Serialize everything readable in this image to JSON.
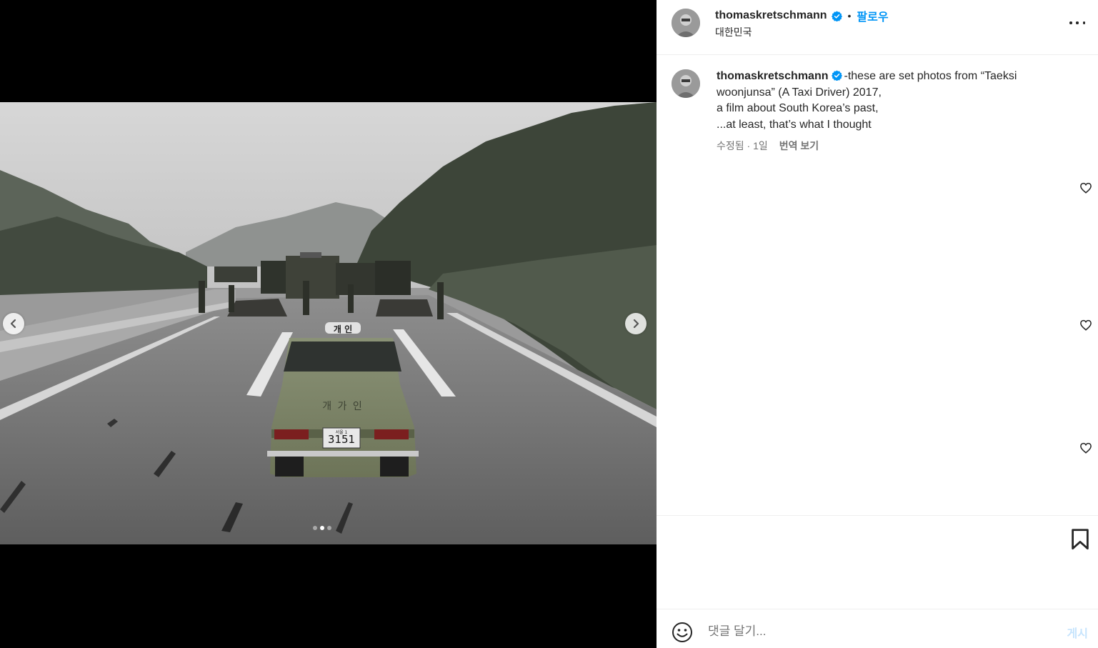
{
  "media": {
    "prev_icon": "chevron-left-icon",
    "next_icon": "chevron-right-icon",
    "carousel": {
      "count": 3,
      "active_index": 1
    },
    "photo_text": {
      "roof_sign": "개 인",
      "door_text": "개 가 인",
      "plate_region": "서울 1",
      "plate_number": "3151"
    }
  },
  "header": {
    "username": "thomaskretschmann",
    "separator": "•",
    "follow_label": "팔로우",
    "location": "대한민국",
    "more_icon": "more-horizontal-icon"
  },
  "caption": {
    "username": "thomaskretschmann",
    "text_line1": "-these are set photos from “Taeksi woonjunsa” (A Taxi Driver) 2017,",
    "text_line2": "a film about South Korea’s past,",
    "text_line3": "...at least, that’s what I thought",
    "meta_time": "수정됨 · 1일",
    "translate_label": "번역 보기"
  },
  "actions": {
    "bookmark_icon": "bookmark-icon",
    "like_icon": "heart-icon"
  },
  "comment": {
    "emoji_icon": "emoji-icon",
    "placeholder": "댓글 달기...",
    "post_label": "게시"
  },
  "colors": {
    "accent": "#0095f6",
    "verified": "#0095f6",
    "text": "#262626",
    "muted": "#737373",
    "post_disabled": "#c6e4fd"
  }
}
